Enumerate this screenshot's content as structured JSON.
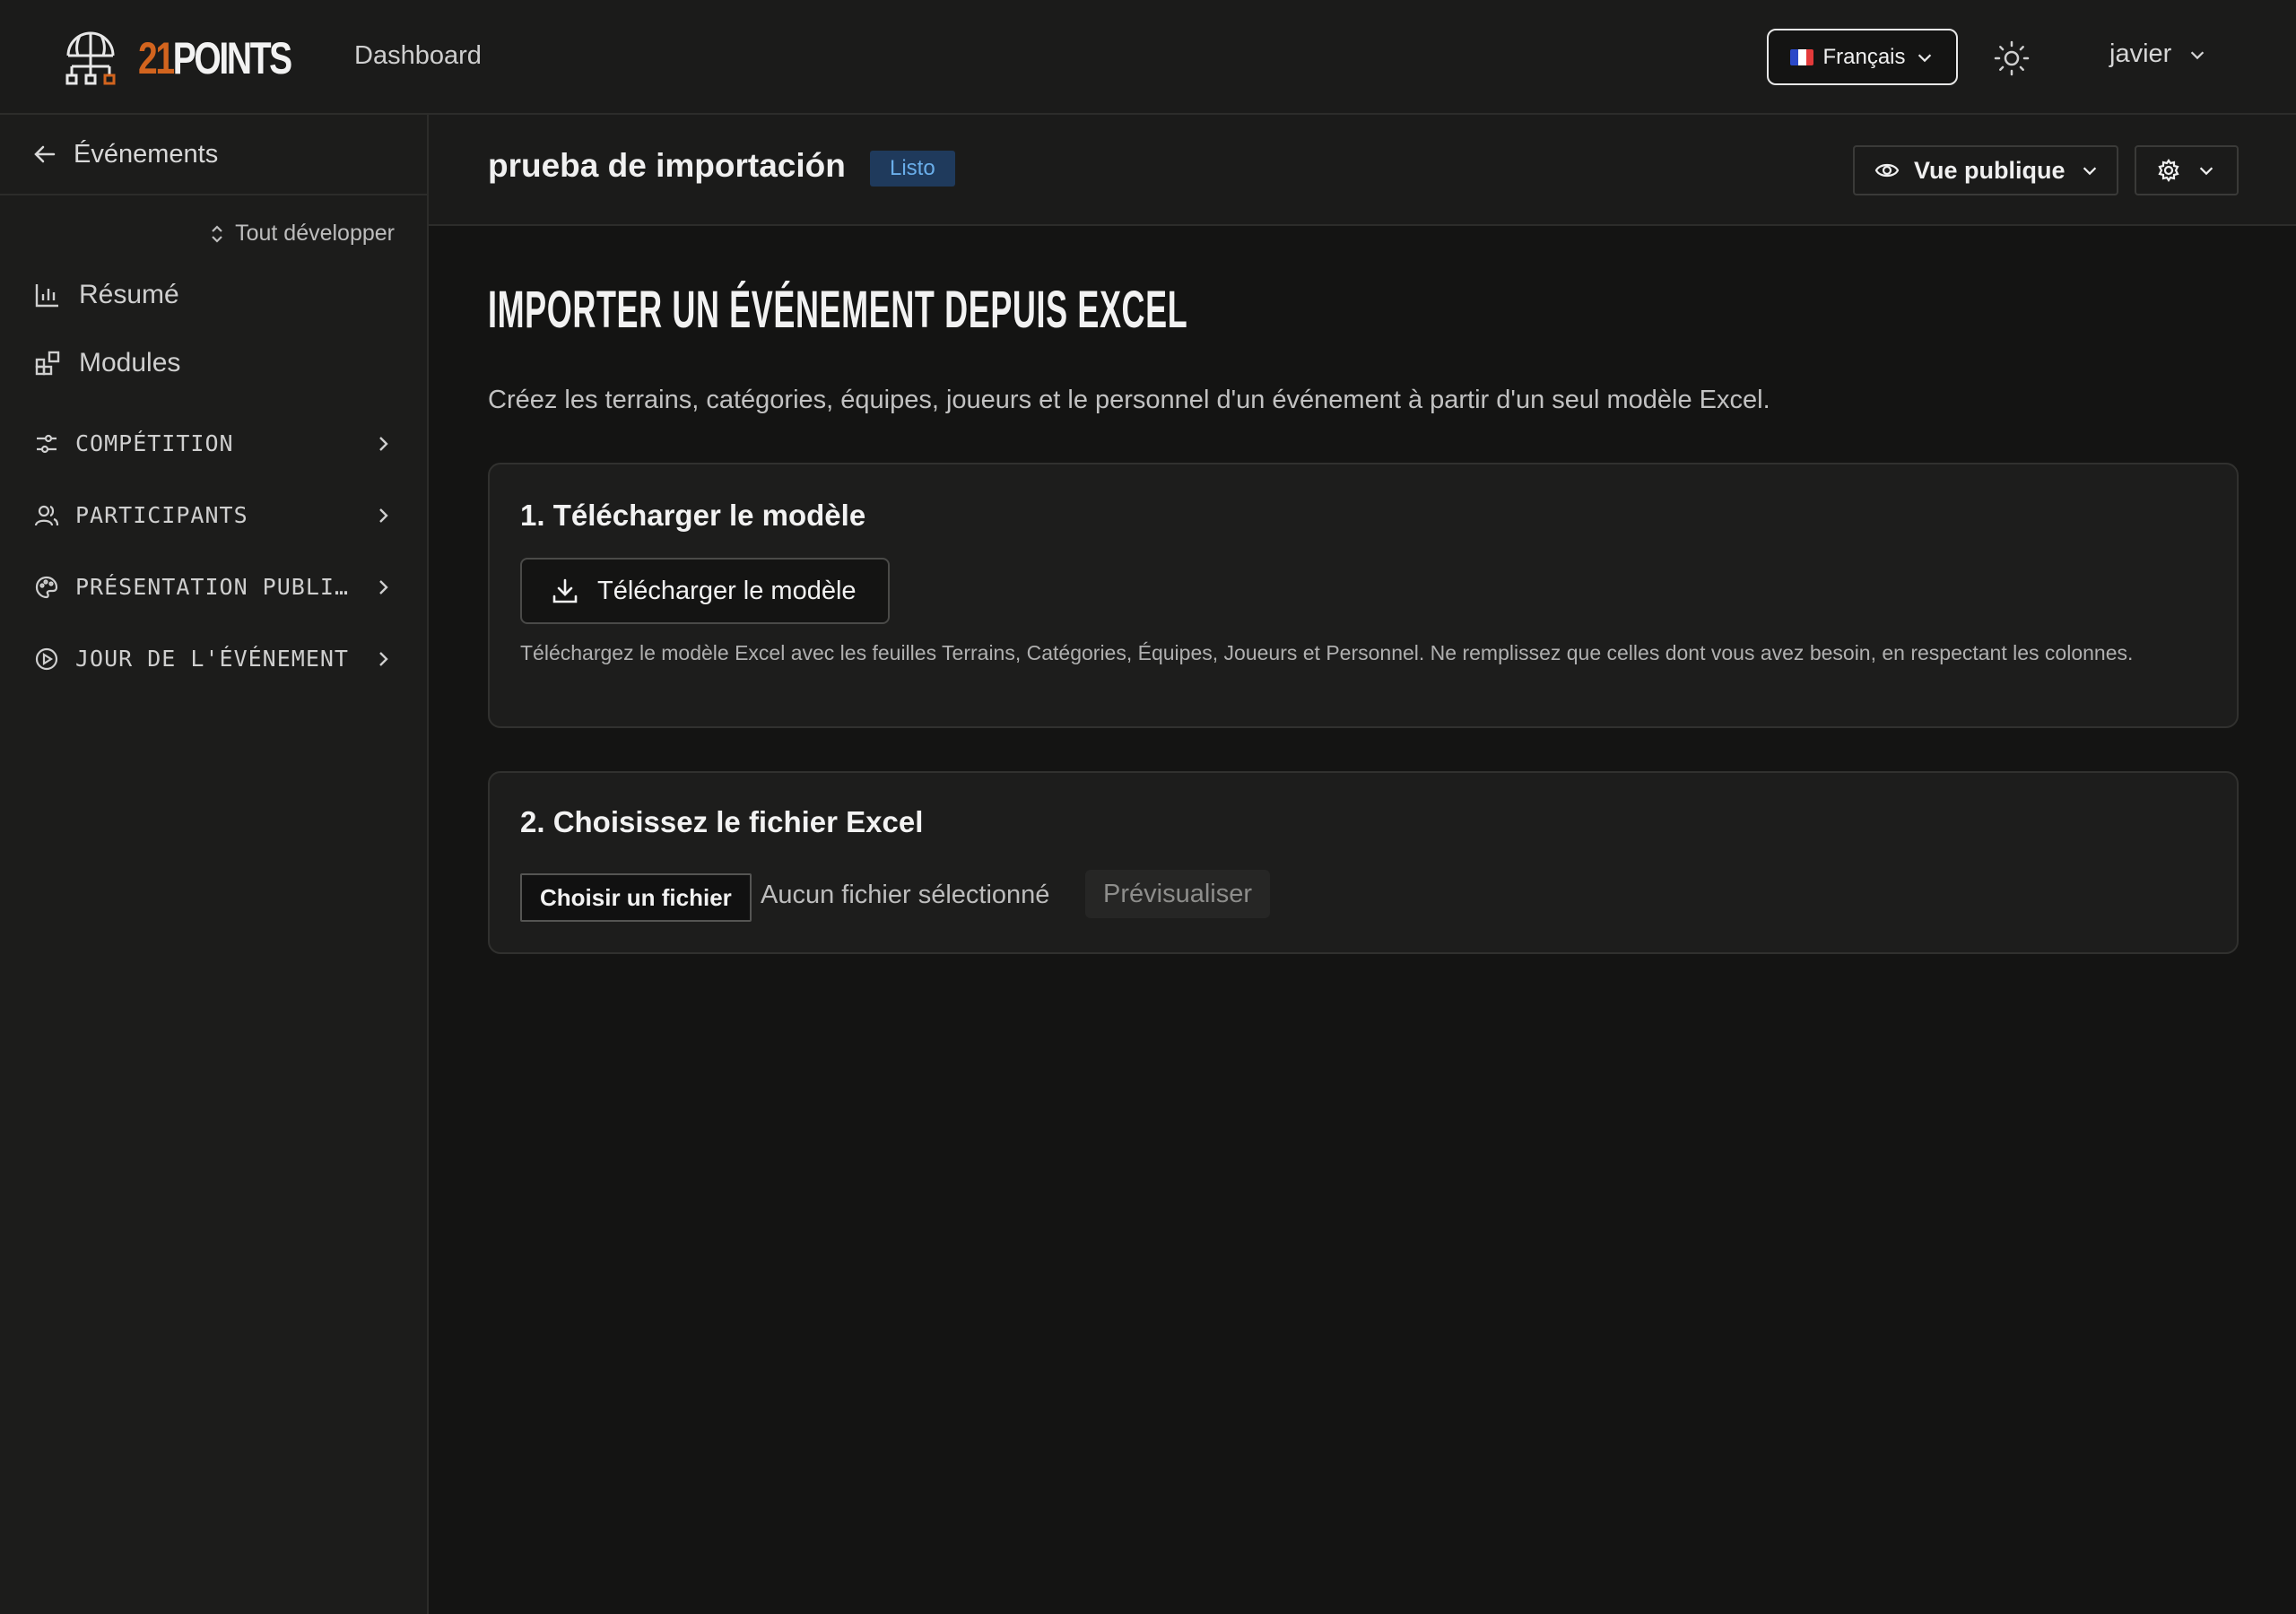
{
  "app": {
    "logo_number": "21",
    "logo_word": "POINTS",
    "nav_dashboard": "Dashboard"
  },
  "header": {
    "language_label": "Français",
    "user_name": "javier"
  },
  "sidebar": {
    "back_label": "Événements",
    "expand_all_label": "Tout développer",
    "items": [
      {
        "label": "Résumé",
        "icon": "bar-chart-icon"
      },
      {
        "label": "Modules",
        "icon": "modules-icon"
      }
    ],
    "groups": [
      {
        "label": "COMPÉTITION",
        "icon": "sliders-icon"
      },
      {
        "label": "PARTICIPANTS",
        "icon": "users-icon"
      },
      {
        "label": "PRÉSENTATION PUBLIQ…",
        "icon": "palette-icon"
      },
      {
        "label": "JOUR DE L'ÉVÉNEMENT",
        "icon": "play-circle-icon"
      }
    ]
  },
  "page": {
    "event_title": "prueba de importación",
    "status_badge": "Listo",
    "public_view_label": "Vue publique",
    "heading": "IMPORTER UN ÉVÉNEMENT DEPUIS EXCEL",
    "intro": "Créez les terrains, catégories, équipes, joueurs et le personnel d'un événement à partir d'un seul modèle Excel."
  },
  "step1": {
    "title": "1. Télécharger le modèle",
    "button_label": "Télécharger le modèle",
    "help": "Téléchargez le modèle Excel avec les feuilles Terrains, Catégories, Équipes, Joueurs et Personnel. Ne remplissez que celles dont vous avez besoin, en respectant les colonnes."
  },
  "step2": {
    "title": "2. Choisissez le fichier Excel",
    "choose_file_label": "Choisir un fichier",
    "no_file_text": "Aucun fichier sélectionné",
    "preview_label": "Prévisualiser"
  },
  "colors": {
    "accent_orange": "#d2641e",
    "badge_bg": "#1f3a5c",
    "badge_text": "#6aaeea",
    "background": "#141413"
  }
}
